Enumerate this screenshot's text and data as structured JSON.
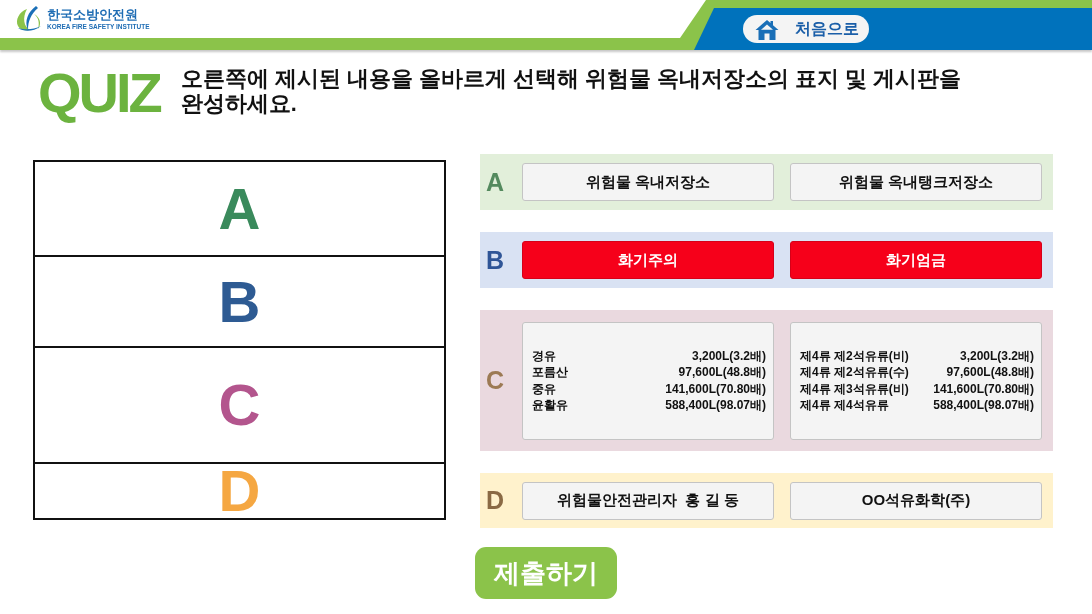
{
  "header": {
    "logo": {
      "name": "한국소방안전원",
      "subtitle": "KOREA FIRE SAFETY INSTITUTE"
    },
    "home_button": {
      "label": "처음으로"
    }
  },
  "quiz": {
    "title": "QUIZ",
    "question": "오른쪽에 제시된 내용을 올바르게 선택해 위험물 옥내저장소의 표지 및 게시판을 완성하세요."
  },
  "answer_board": {
    "slots": [
      {
        "label": "A",
        "color": "#3a8a5c"
      },
      {
        "label": "B",
        "color": "#2e5b93"
      },
      {
        "label": "C",
        "color": "#b3558d"
      },
      {
        "label": "D",
        "color": "#f5a742"
      }
    ]
  },
  "option_groups": [
    {
      "label": "A",
      "color": "#548a5e",
      "kind": "text",
      "options": [
        {
          "label": "위험물 옥내저장소",
          "selected": false
        },
        {
          "label": "위험물 옥내탱크저장소",
          "selected": false
        }
      ]
    },
    {
      "label": "B",
      "color": "#2f5597",
      "kind": "sign",
      "options": [
        {
          "label": "화기주의",
          "selected": false
        },
        {
          "label": "화기엄금",
          "selected": false
        }
      ]
    },
    {
      "label": "C",
      "color": "#9c7a54",
      "kind": "table",
      "options": [
        {
          "selected": false,
          "rows": [
            {
              "name": "경유",
              "amount": "3,200L(3.2배)"
            },
            {
              "name": "포름산",
              "amount": "97,600L(48.8배)"
            },
            {
              "name": "중유",
              "amount": "141,600L(70.80배)"
            },
            {
              "name": "윤활유",
              "amount": "588,400L(98.07배)"
            }
          ]
        },
        {
          "selected": false,
          "rows": [
            {
              "name": "제4류 제2석유류(비)",
              "amount": "3,200L(3.2배)"
            },
            {
              "name": "제4류 제2석유류(수)",
              "amount": "97,600L(48.8배)"
            },
            {
              "name": "제4류 제3석유류(비)",
              "amount": "141,600L(70.80배)"
            },
            {
              "name": "제4류 제4석유류",
              "amount": "588,400L(98.07배)"
            }
          ]
        }
      ]
    },
    {
      "label": "D",
      "color": "#8a6a44",
      "kind": "text",
      "options": [
        {
          "label": "위험물안전관리자  홍 길 동",
          "selected": false
        },
        {
          "label": "OO석유화학(주)",
          "selected": false
        }
      ]
    }
  ],
  "submit_button": {
    "label": "제출하기"
  }
}
